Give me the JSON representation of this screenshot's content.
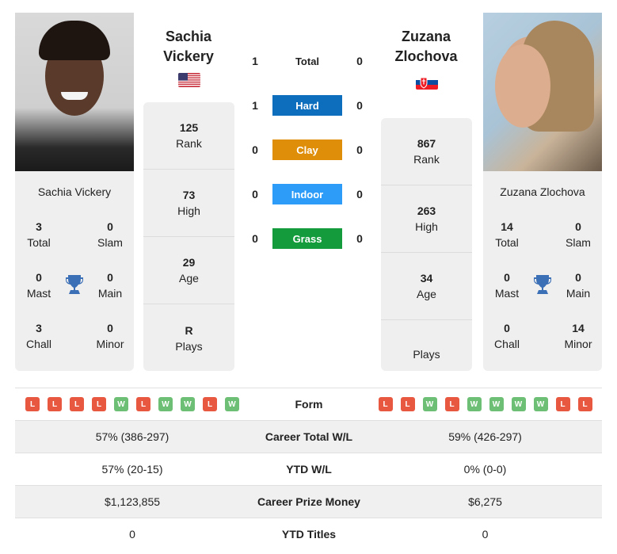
{
  "colors": {
    "hard": "#0d6ebd",
    "clay": "#df8e0a",
    "indoor": "#2c9cf8",
    "grass": "#139b3c",
    "win": "#6cbf74",
    "loss": "#e8573f",
    "trophy": "#3b6fb6"
  },
  "player1": {
    "name": "Sachia Vickery",
    "title_line1": "Sachia",
    "title_line2": "Vickery",
    "flag": "us-flag",
    "rank": "125",
    "rank_label": "Rank",
    "high": "73",
    "high_label": "High",
    "age": "29",
    "age_label": "Age",
    "plays": "R",
    "plays_label": "Plays",
    "titles": {
      "total": "3",
      "total_label": "Total",
      "slam": "0",
      "slam_label": "Slam",
      "mast": "0",
      "mast_label": "Mast",
      "main": "0",
      "main_label": "Main",
      "chall": "3",
      "chall_label": "Chall",
      "minor": "0",
      "minor_label": "Minor"
    },
    "form": [
      "L",
      "L",
      "L",
      "L",
      "W",
      "L",
      "W",
      "W",
      "L",
      "W"
    ]
  },
  "player2": {
    "name": "Zuzana Zlochova",
    "title_line1": "Zuzana",
    "title_line2": "Zlochova",
    "flag": "slovakia-flag",
    "rank": "867",
    "rank_label": "Rank",
    "high": "263",
    "high_label": "High",
    "age": "34",
    "age_label": "Age",
    "plays": "",
    "plays_label": "Plays",
    "titles": {
      "total": "14",
      "total_label": "Total",
      "slam": "0",
      "slam_label": "Slam",
      "mast": "0",
      "mast_label": "Mast",
      "main": "0",
      "main_label": "Main",
      "chall": "0",
      "chall_label": "Chall",
      "minor": "14",
      "minor_label": "Minor"
    },
    "form": [
      "L",
      "L",
      "W",
      "L",
      "W",
      "W",
      "W",
      "W",
      "L",
      "L"
    ]
  },
  "h2h": [
    {
      "label": "Total",
      "p1": "1",
      "p2": "0"
    },
    {
      "label": "Hard",
      "p1": "1",
      "p2": "0"
    },
    {
      "label": "Clay",
      "p1": "0",
      "p2": "0"
    },
    {
      "label": "Indoor",
      "p1": "0",
      "p2": "0"
    },
    {
      "label": "Grass",
      "p1": "0",
      "p2": "0"
    }
  ],
  "comparison": {
    "form_label": "Form",
    "rows": [
      {
        "label": "Career Total W/L",
        "p1": "57% (386-297)",
        "p2": "59% (426-297)"
      },
      {
        "label": "YTD W/L",
        "p1": "57% (20-15)",
        "p2": "0% (0-0)"
      },
      {
        "label": "Career Prize Money",
        "p1": "$1,123,855",
        "p2": "$6,275"
      },
      {
        "label": "YTD Titles",
        "p1": "0",
        "p2": "0"
      }
    ]
  }
}
